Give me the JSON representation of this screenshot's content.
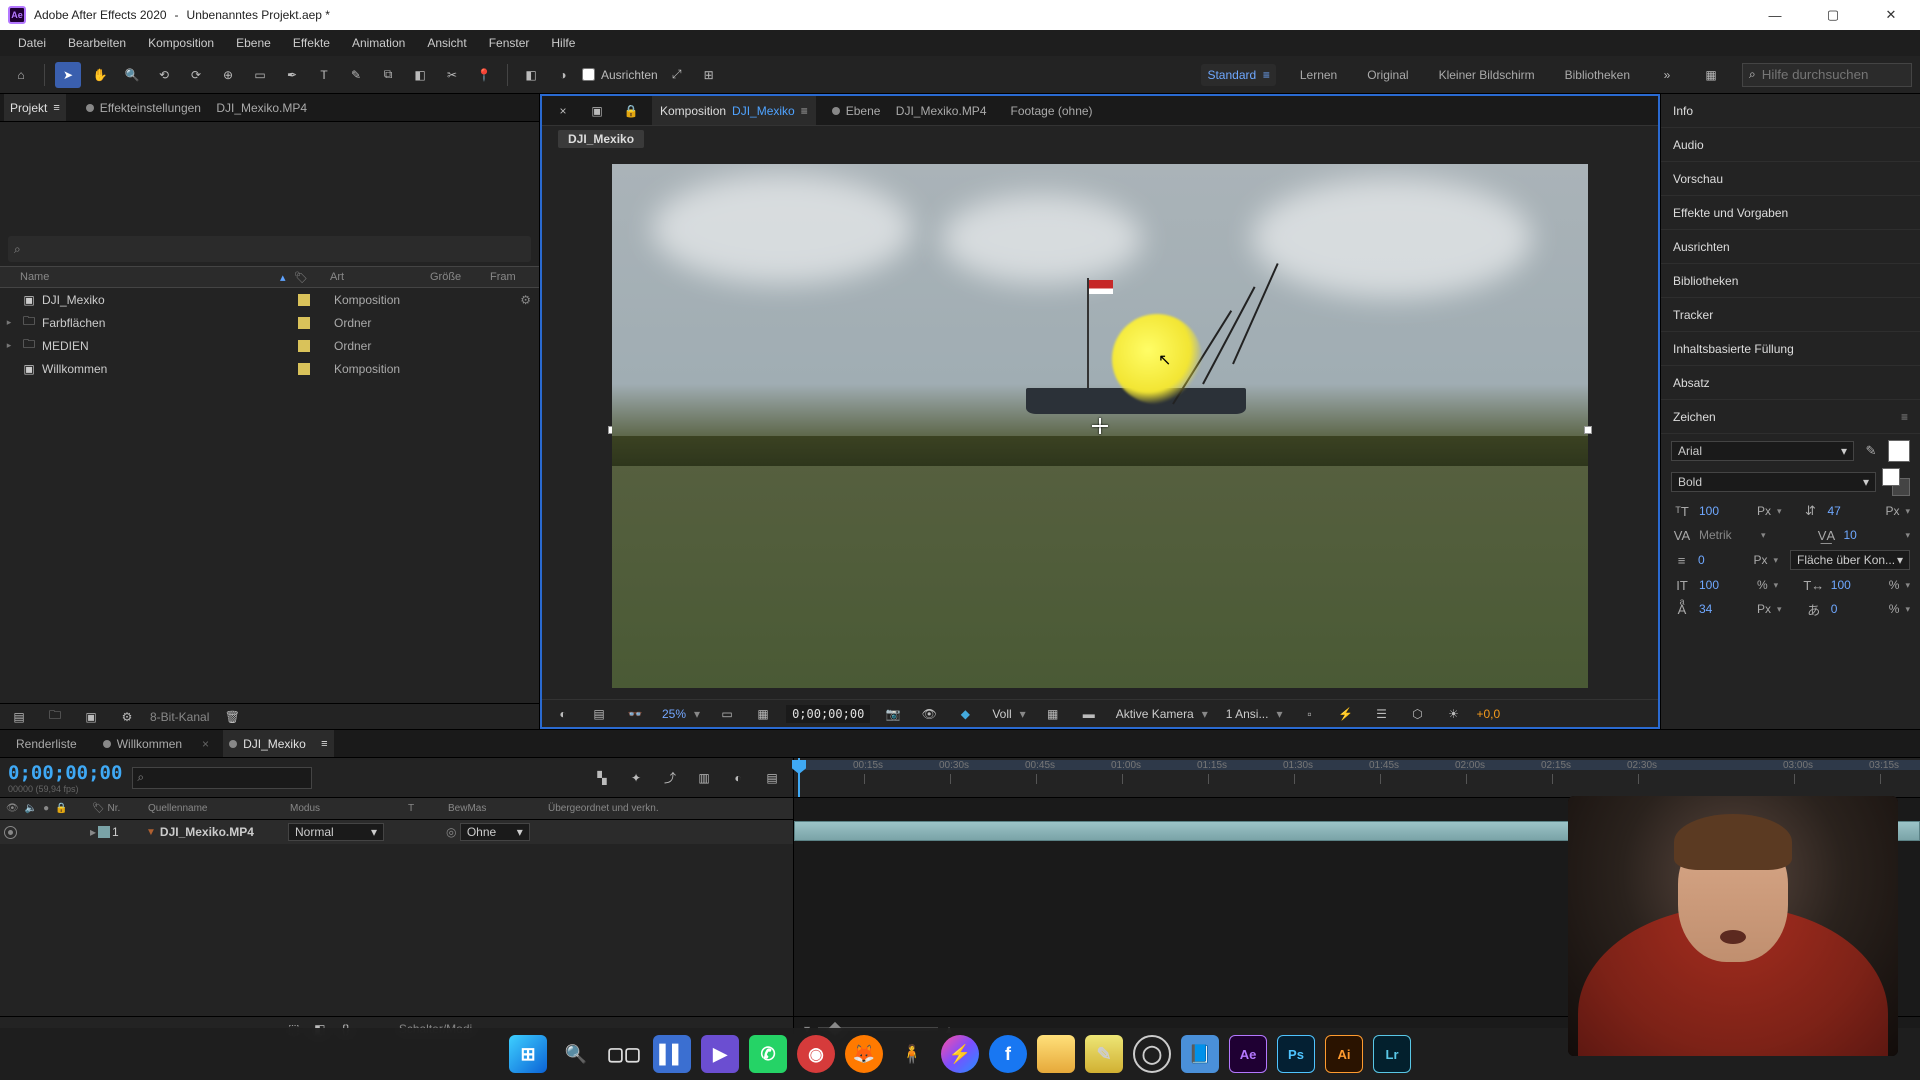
{
  "titlebar": {
    "app": "Adobe After Effects 2020",
    "project": "Unbenanntes Projekt.aep *",
    "logo_text": "Ae"
  },
  "menu": [
    "Datei",
    "Bearbeiten",
    "Komposition",
    "Ebene",
    "Effekte",
    "Animation",
    "Ansicht",
    "Fenster",
    "Hilfe"
  ],
  "toolbar": {
    "align_label": "Ausrichten",
    "search_placeholder": "Hilfe durchsuchen"
  },
  "workspaces": {
    "items": [
      "Standard",
      "Lernen",
      "Original",
      "Kleiner Bildschirm",
      "Bibliotheken"
    ],
    "active": "Standard"
  },
  "project_panel": {
    "tabs": {
      "project": "Projekt",
      "effect_controls_prefix": "Effekteinstellungen",
      "effect_controls_target": "DJI_Mexiko.MP4"
    },
    "columns": {
      "name": "Name",
      "art": "Art",
      "size": "Größe",
      "frame": "Fram"
    },
    "items": [
      {
        "name": "DJI_Mexiko",
        "kind": "comp",
        "art": "Komposition"
      },
      {
        "name": "Farbflächen",
        "kind": "folder",
        "art": "Ordner"
      },
      {
        "name": "MEDIEN",
        "kind": "folder",
        "art": "Ordner"
      },
      {
        "name": "Willkommen",
        "kind": "comp",
        "art": "Komposition"
      }
    ],
    "footer_depth": "8-Bit-Kanal"
  },
  "comp_view": {
    "tabs": {
      "composition_prefix": "Komposition",
      "composition_name": "DJI_Mexiko",
      "layer_prefix": "Ebene",
      "layer_name": "DJI_Mexiko.MP4",
      "footage": "Footage  (ohne)"
    },
    "breadcrumb": "DJI_Mexiko",
    "footer": {
      "zoom": "25%",
      "timecode": "0;00;00;00",
      "resolution": "Voll",
      "camera": "Aktive Kamera",
      "views": "1 Ansi...",
      "exposure": "+0,0"
    }
  },
  "right_panels": {
    "info": "Info",
    "audio": "Audio",
    "preview": "Vorschau",
    "effects": "Effekte und Vorgaben",
    "align": "Ausrichten",
    "libraries": "Bibliotheken",
    "tracker": "Tracker",
    "content_fill": "Inhaltsbasierte Füllung",
    "paragraph": "Absatz",
    "character": "Zeichen"
  },
  "character": {
    "font": "Arial",
    "style": "Bold",
    "size_val": "100",
    "size_unit": "Px",
    "leading_val": "47",
    "leading_unit": "Px",
    "kerning": "Metrik",
    "tracking": "10",
    "stroke_val": "0",
    "stroke_unit": "Px",
    "stroke_mode": "Fläche über Kon...",
    "vscale": "100",
    "vscale_unit": "%",
    "hscale": "100",
    "hscale_unit": "%",
    "baseline": "34",
    "baseline_unit": "Px",
    "tsume": "0",
    "tsume_unit": "%"
  },
  "timeline": {
    "tabs": {
      "render": "Renderliste",
      "welcome": "Willkommen",
      "active": "DJI_Mexiko"
    },
    "cti": "0;00;00;00",
    "cti_sub": "00000 (59,94 fps)",
    "cols": {
      "nr": "Nr.",
      "source": "Quellenname",
      "mode": "Modus",
      "t": "T",
      "matte": "BewMas",
      "parent": "Übergeordnet und verkn."
    },
    "layer": {
      "index": "1",
      "name": "DJI_Mexiko.MP4",
      "mode": "Normal",
      "matte": "Ohne"
    },
    "footer": "Schalter/Modi",
    "ticks": [
      "00:15s",
      "00:30s",
      "00:45s",
      "01:00s",
      "01:15s",
      "01:30s",
      "01:45s",
      "02:00s",
      "02:15s",
      "02:30s",
      "03:00s",
      "03:15s"
    ]
  },
  "taskbar": {
    "apps": [
      "windows",
      "search",
      "tasks",
      "widget",
      "video",
      "whatsapp",
      "mail",
      "firefox",
      "person",
      "messenger",
      "facebook",
      "explorer",
      "note",
      "obs",
      "settings",
      "ae",
      "ps",
      "ai",
      "lr"
    ]
  }
}
